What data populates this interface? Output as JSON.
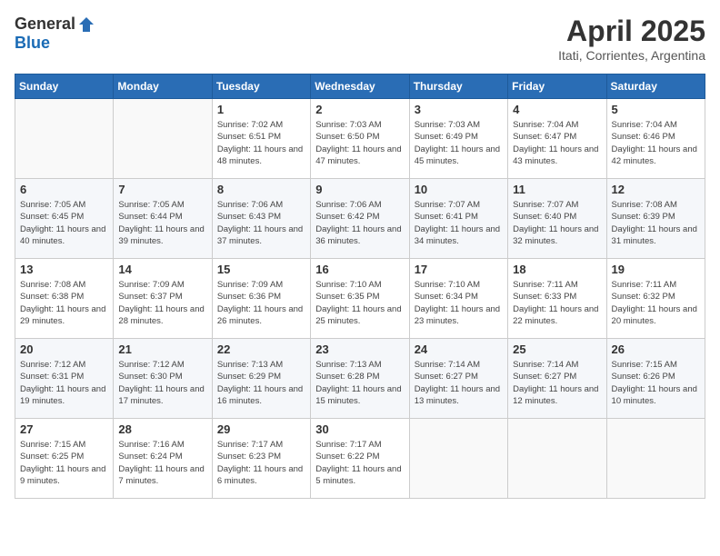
{
  "logo": {
    "general": "General",
    "blue": "Blue"
  },
  "title": "April 2025",
  "subtitle": "Itati, Corrientes, Argentina",
  "days_header": [
    "Sunday",
    "Monday",
    "Tuesday",
    "Wednesday",
    "Thursday",
    "Friday",
    "Saturday"
  ],
  "weeks": [
    [
      {
        "day": "",
        "info": ""
      },
      {
        "day": "",
        "info": ""
      },
      {
        "day": "1",
        "info": "Sunrise: 7:02 AM\nSunset: 6:51 PM\nDaylight: 11 hours and 48 minutes."
      },
      {
        "day": "2",
        "info": "Sunrise: 7:03 AM\nSunset: 6:50 PM\nDaylight: 11 hours and 47 minutes."
      },
      {
        "day": "3",
        "info": "Sunrise: 7:03 AM\nSunset: 6:49 PM\nDaylight: 11 hours and 45 minutes."
      },
      {
        "day": "4",
        "info": "Sunrise: 7:04 AM\nSunset: 6:47 PM\nDaylight: 11 hours and 43 minutes."
      },
      {
        "day": "5",
        "info": "Sunrise: 7:04 AM\nSunset: 6:46 PM\nDaylight: 11 hours and 42 minutes."
      }
    ],
    [
      {
        "day": "6",
        "info": "Sunrise: 7:05 AM\nSunset: 6:45 PM\nDaylight: 11 hours and 40 minutes."
      },
      {
        "day": "7",
        "info": "Sunrise: 7:05 AM\nSunset: 6:44 PM\nDaylight: 11 hours and 39 minutes."
      },
      {
        "day": "8",
        "info": "Sunrise: 7:06 AM\nSunset: 6:43 PM\nDaylight: 11 hours and 37 minutes."
      },
      {
        "day": "9",
        "info": "Sunrise: 7:06 AM\nSunset: 6:42 PM\nDaylight: 11 hours and 36 minutes."
      },
      {
        "day": "10",
        "info": "Sunrise: 7:07 AM\nSunset: 6:41 PM\nDaylight: 11 hours and 34 minutes."
      },
      {
        "day": "11",
        "info": "Sunrise: 7:07 AM\nSunset: 6:40 PM\nDaylight: 11 hours and 32 minutes."
      },
      {
        "day": "12",
        "info": "Sunrise: 7:08 AM\nSunset: 6:39 PM\nDaylight: 11 hours and 31 minutes."
      }
    ],
    [
      {
        "day": "13",
        "info": "Sunrise: 7:08 AM\nSunset: 6:38 PM\nDaylight: 11 hours and 29 minutes."
      },
      {
        "day": "14",
        "info": "Sunrise: 7:09 AM\nSunset: 6:37 PM\nDaylight: 11 hours and 28 minutes."
      },
      {
        "day": "15",
        "info": "Sunrise: 7:09 AM\nSunset: 6:36 PM\nDaylight: 11 hours and 26 minutes."
      },
      {
        "day": "16",
        "info": "Sunrise: 7:10 AM\nSunset: 6:35 PM\nDaylight: 11 hours and 25 minutes."
      },
      {
        "day": "17",
        "info": "Sunrise: 7:10 AM\nSunset: 6:34 PM\nDaylight: 11 hours and 23 minutes."
      },
      {
        "day": "18",
        "info": "Sunrise: 7:11 AM\nSunset: 6:33 PM\nDaylight: 11 hours and 22 minutes."
      },
      {
        "day": "19",
        "info": "Sunrise: 7:11 AM\nSunset: 6:32 PM\nDaylight: 11 hours and 20 minutes."
      }
    ],
    [
      {
        "day": "20",
        "info": "Sunrise: 7:12 AM\nSunset: 6:31 PM\nDaylight: 11 hours and 19 minutes."
      },
      {
        "day": "21",
        "info": "Sunrise: 7:12 AM\nSunset: 6:30 PM\nDaylight: 11 hours and 17 minutes."
      },
      {
        "day": "22",
        "info": "Sunrise: 7:13 AM\nSunset: 6:29 PM\nDaylight: 11 hours and 16 minutes."
      },
      {
        "day": "23",
        "info": "Sunrise: 7:13 AM\nSunset: 6:28 PM\nDaylight: 11 hours and 15 minutes."
      },
      {
        "day": "24",
        "info": "Sunrise: 7:14 AM\nSunset: 6:27 PM\nDaylight: 11 hours and 13 minutes."
      },
      {
        "day": "25",
        "info": "Sunrise: 7:14 AM\nSunset: 6:27 PM\nDaylight: 11 hours and 12 minutes."
      },
      {
        "day": "26",
        "info": "Sunrise: 7:15 AM\nSunset: 6:26 PM\nDaylight: 11 hours and 10 minutes."
      }
    ],
    [
      {
        "day": "27",
        "info": "Sunrise: 7:15 AM\nSunset: 6:25 PM\nDaylight: 11 hours and 9 minutes."
      },
      {
        "day": "28",
        "info": "Sunrise: 7:16 AM\nSunset: 6:24 PM\nDaylight: 11 hours and 7 minutes."
      },
      {
        "day": "29",
        "info": "Sunrise: 7:17 AM\nSunset: 6:23 PM\nDaylight: 11 hours and 6 minutes."
      },
      {
        "day": "30",
        "info": "Sunrise: 7:17 AM\nSunset: 6:22 PM\nDaylight: 11 hours and 5 minutes."
      },
      {
        "day": "",
        "info": ""
      },
      {
        "day": "",
        "info": ""
      },
      {
        "day": "",
        "info": ""
      }
    ]
  ]
}
